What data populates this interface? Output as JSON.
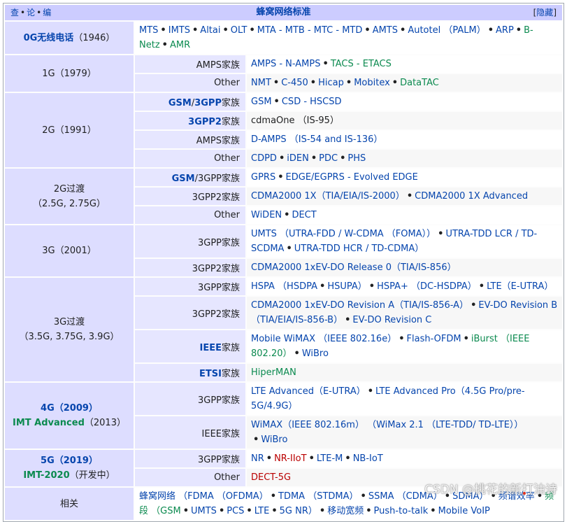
{
  "navbox": {
    "vde": [
      "查",
      "论",
      "编"
    ],
    "title": "蜂窝网络标准",
    "hide": {
      "open": "[",
      "label": "隐藏",
      "close": "]"
    }
  },
  "groups": [
    {
      "label_lines": [
        [
          {
            "t": "0G无线电话",
            "c": "bl"
          },
          {
            "t": "（1946）",
            "c": "plain"
          }
        ]
      ],
      "rows": [
        {
          "sub": null,
          "items": [
            {
              "t": "MTS",
              "c": "bl"
            },
            {
              "t": "IMTS",
              "c": "bl"
            },
            {
              "t": "Altai",
              "c": "bl"
            },
            {
              "t": "OLT",
              "c": "bl"
            },
            {
              "t": "MTA - MTB - MTC - MTD",
              "c": "bl"
            },
            {
              "t": "AMTS",
              "c": "bl"
            },
            {
              "t": "Autotel （PALM）",
              "c": "bl"
            },
            {
              "t": "ARP",
              "c": "bl"
            },
            {
              "t": "B-Netz",
              "c": "gr"
            },
            {
              "t": "AMR",
              "c": "gr"
            }
          ]
        }
      ]
    },
    {
      "label_lines": [
        [
          {
            "t": "1G（1979）",
            "c": "plain"
          }
        ]
      ],
      "rows": [
        {
          "sub": [
            {
              "t": "AMPS",
              "c": "plain"
            },
            {
              "t": "家族",
              "c": "plain"
            }
          ],
          "items": [
            {
              "t": "AMPS - N-AMPS",
              "c": "bl"
            },
            {
              "t": "TACS - ETACS",
              "c": "gr"
            }
          ]
        },
        {
          "sub": [
            {
              "t": "Other",
              "c": "plain"
            }
          ],
          "items": [
            {
              "t": "NMT",
              "c": "bl"
            },
            {
              "t": "C-450",
              "c": "bl"
            },
            {
              "t": "Hicap",
              "c": "bl"
            },
            {
              "t": "Mobitex",
              "c": "bl"
            },
            {
              "t": "DataTAC",
              "c": "gr"
            }
          ]
        }
      ]
    },
    {
      "label_lines": [
        [
          {
            "t": "2G（1991）",
            "c": "plain"
          }
        ]
      ],
      "rows": [
        {
          "sub": [
            {
              "t": "GSM",
              "c": "bl"
            },
            {
              "t": "/",
              "c": "plain"
            },
            {
              "t": "3GPP",
              "c": "bl"
            },
            {
              "t": "家族",
              "c": "plain"
            }
          ],
          "items": [
            {
              "t": "GSM",
              "c": "bl"
            },
            {
              "t": "CSD - HSCSD",
              "c": "bl"
            }
          ]
        },
        {
          "sub": [
            {
              "t": "3GPP2",
              "c": "bl"
            },
            {
              "t": "家族",
              "c": "plain"
            }
          ],
          "items": [
            {
              "t": "cdmaOne （IS-95）",
              "c": "plain"
            }
          ]
        },
        {
          "sub": [
            {
              "t": "AMPS",
              "c": "plain"
            },
            {
              "t": "家族",
              "c": "plain"
            }
          ],
          "items": [
            {
              "t": "D-AMPS （IS-54 and IS-136）",
              "c": "bl"
            }
          ]
        },
        {
          "sub": [
            {
              "t": "Other",
              "c": "plain"
            }
          ],
          "items": [
            {
              "t": "CDPD",
              "c": "bl"
            },
            {
              "t": "iDEN",
              "c": "bl"
            },
            {
              "t": "PDC",
              "c": "bl"
            },
            {
              "t": "PHS",
              "c": "bl"
            }
          ]
        }
      ]
    },
    {
      "label_lines": [
        [
          {
            "t": "2G过渡",
            "c": "plain"
          }
        ],
        [
          {
            "t": "（2.5G, 2.75G）",
            "c": "plain"
          }
        ]
      ],
      "rows": [
        {
          "sub": [
            {
              "t": "GSM",
              "c": "bl"
            },
            {
              "t": "/3GPP家族",
              "c": "plain"
            }
          ],
          "items": [
            {
              "t": "GPRS",
              "c": "bl"
            },
            {
              "t": "EDGE/EGPRS - Evolved EDGE",
              "c": "bl"
            }
          ]
        },
        {
          "sub": [
            {
              "t": "3GPP2家族",
              "c": "plain"
            }
          ],
          "items": [
            {
              "t": "CDMA2000 1X（TIA/EIA/IS-2000）",
              "c": "bl"
            },
            {
              "t": "CDMA2000 1X Advanced",
              "c": "bl"
            }
          ]
        },
        {
          "sub": [
            {
              "t": "Other",
              "c": "plain"
            }
          ],
          "items": [
            {
              "t": "WiDEN",
              "c": "bl"
            },
            {
              "t": "DECT",
              "c": "bl"
            }
          ]
        }
      ]
    },
    {
      "label_lines": [
        [
          {
            "t": "3G（2001）",
            "c": "plain"
          }
        ]
      ],
      "rows": [
        {
          "sub": [
            {
              "t": "3GPP家族",
              "c": "plain"
            }
          ],
          "items": [
            {
              "t": "UMTS （UTRA-FDD / W-CDMA （FOMA））",
              "c": "bl"
            },
            {
              "t": "UTRA-TDD LCR / TD-SCDMA",
              "c": "bl"
            },
            {
              "t": "UTRA-TDD HCR / TD-CDMA）",
              "c": "bl"
            }
          ]
        },
        {
          "sub": [
            {
              "t": "3GPP2家族",
              "c": "plain"
            }
          ],
          "items": [
            {
              "t": "CDMA2000 1xEV-DO Release 0（TIA/IS-856）",
              "c": "bl"
            }
          ]
        }
      ]
    },
    {
      "label_lines": [
        [
          {
            "t": "3G过渡",
            "c": "plain"
          }
        ],
        [
          {
            "t": "（3.5G, 3.75G, 3.9G）",
            "c": "plain"
          }
        ]
      ],
      "rows": [
        {
          "sub": [
            {
              "t": "3GPP家族",
              "c": "plain"
            }
          ],
          "items": [
            {
              "t": "HSPA （HSDPA",
              "c": "bl"
            },
            {
              "t": "HSUPA）",
              "c": "bl"
            },
            {
              "t": "HSPA+ （DC-HSDPA）",
              "c": "bl"
            },
            {
              "t": "LTE（E-UTRA）",
              "c": "bl"
            }
          ]
        },
        {
          "sub": [
            {
              "t": "3GPP2家族",
              "c": "plain"
            }
          ],
          "items": [
            {
              "t": "CDMA2000 1xEV-DO Revision A（TIA/IS-856-A）",
              "c": "bl"
            },
            {
              "t": "EV-DO Revision B（TIA/EIA/IS-856-B）",
              "c": "bl"
            },
            {
              "t": "EV-DO Revision C",
              "c": "bl"
            }
          ]
        },
        {
          "sub": [
            {
              "t": "IEEE",
              "c": "bl"
            },
            {
              "t": "家族",
              "c": "plain"
            }
          ],
          "items": [
            {
              "t": "Mobile WiMAX （IEEE 802.16e）",
              "c": "bl"
            },
            {
              "t": "Flash-OFDM",
              "c": "bl"
            },
            {
              "t": "iBurst （IEEE 802.20）",
              "c": "gr"
            },
            {
              "t": "WiBro",
              "c": "bl"
            }
          ]
        },
        {
          "sub": [
            {
              "t": "ETSI",
              "c": "bl"
            },
            {
              "t": "家族",
              "c": "plain"
            }
          ],
          "items": [
            {
              "t": "HiperMAN",
              "c": "gr"
            }
          ]
        }
      ]
    },
    {
      "label_lines": [
        [
          {
            "t": "4G（2009）",
            "c": "bl"
          }
        ],
        [
          {
            "t": "IMT Advanced",
            "c": "gr"
          },
          {
            "t": "（2013）",
            "c": "plain"
          }
        ]
      ],
      "rows": [
        {
          "sub": [
            {
              "t": "3GPP家族",
              "c": "plain"
            }
          ],
          "items": [
            {
              "t": "LTE Advanced（E-UTRA）",
              "c": "bl"
            },
            {
              "t": "LTE Advanced Pro（4.5G Pro/pre-5G/4.9G）",
              "c": "bl"
            }
          ]
        },
        {
          "sub": [
            {
              "t": "IEEE家族",
              "c": "plain"
            }
          ],
          "items": [
            {
              "t": "WiMAX（IEEE 802.16m） （WiMax 2.1 （LTE-TDD/ TD-LTE））",
              "c": "bl"
            },
            {
              "t": "WiBro",
              "c": "bl"
            }
          ]
        }
      ]
    },
    {
      "label_lines": [
        [
          {
            "t": "5G（2019）",
            "c": "bl"
          }
        ],
        [
          {
            "t": "IMT-2020",
            "c": "gr"
          },
          {
            "t": "（开发中）",
            "c": "plain"
          }
        ]
      ],
      "rows": [
        {
          "sub": [
            {
              "t": "3GPP家族",
              "c": "plain"
            }
          ],
          "items": [
            {
              "t": "NR",
              "c": "bl"
            },
            {
              "t": "NR-IIoT",
              "c": "rd"
            },
            {
              "t": "LTE-M",
              "c": "bl"
            },
            {
              "t": "NB-IoT",
              "c": "bl"
            }
          ]
        },
        {
          "sub": [
            {
              "t": "Other",
              "c": "plain"
            }
          ],
          "items": [
            {
              "t": "DECT-5G",
              "c": "rd"
            }
          ]
        }
      ]
    },
    {
      "label_lines": [
        [
          {
            "t": "相关",
            "c": "plain"
          }
        ]
      ],
      "rows": [
        {
          "sub": null,
          "items": [
            {
              "t": "蜂窝网络 （FDMA （OFDMA）",
              "c": "bl"
            },
            {
              "t": "TDMA （STDMA）",
              "c": "bl"
            },
            {
              "t": "SSMA （CDMA）",
              "c": "bl"
            },
            {
              "t": "SDMA）",
              "c": "bl"
            },
            {
              "t": "频谱效率",
              "c": "bl"
            },
            {
              "t": "频段 （GSM",
              "c": "gr"
            },
            {
              "t": "UMTS",
              "c": "bl"
            },
            {
              "t": "PCS",
              "c": "bl"
            },
            {
              "t": "LTE",
              "c": "bl"
            },
            {
              "t": "5G NR）",
              "c": "bl"
            },
            {
              "t": "移动宽频",
              "c": "bl"
            },
            {
              "t": "Push-to-talk",
              "c": "bl"
            },
            {
              "t": "Mobile VoIP",
              "c": "bl"
            }
          ]
        }
      ]
    }
  ],
  "watermark": "CSDN @桃花的新打油诗"
}
